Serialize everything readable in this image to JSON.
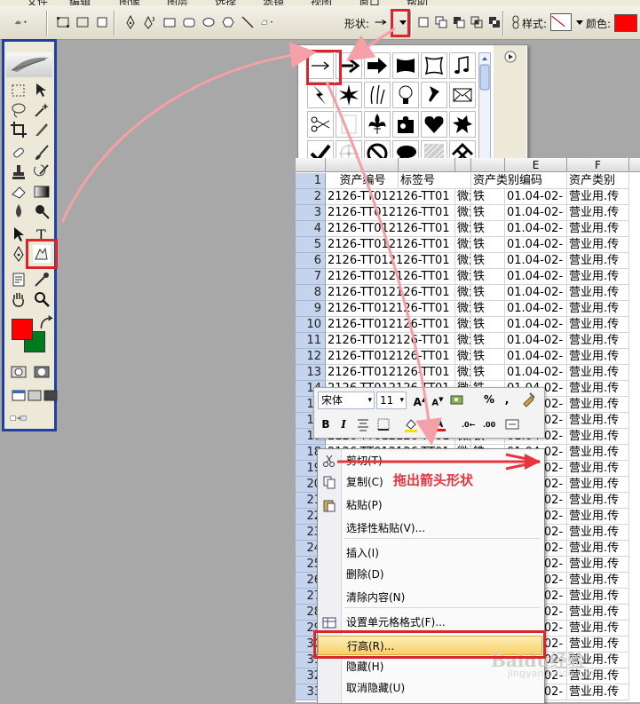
{
  "menubar": {
    "items": [
      "文件",
      "编辑",
      "图像",
      "图层",
      "选择",
      "滤镜",
      "视图",
      "窗口",
      "帮助"
    ]
  },
  "options_bar": {
    "shape_label": "形状:",
    "style_label": "样式:",
    "color_label": "颜色:",
    "color_value": "#ff0000"
  },
  "shapes_panel": {
    "shapes": [
      "thin-arrow",
      "arrow",
      "bold-arrow",
      "banner",
      "frame",
      "music-note",
      "lightning",
      "starburst",
      "grass",
      "lightbulb",
      "pushpin",
      "envelope",
      "scissors",
      "blank-page",
      "fleur-de-lis",
      "puzzle",
      "heart",
      "splat",
      "checkmark",
      "target",
      "no-sign",
      "speech-bubble",
      "hatch-square",
      "checker-diamond"
    ]
  },
  "sheet": {
    "columns": [
      {
        "letter": "",
        "title": ""
      },
      {
        "letter": "",
        "title": "资产编号"
      },
      {
        "letter": "",
        "title": "标签号"
      },
      {
        "letter": "",
        "title": ""
      },
      {
        "letter": "",
        "title": "资产类别编码"
      },
      {
        "letter": "E",
        "title": ""
      },
      {
        "letter": "F",
        "title": "资产类别"
      },
      {
        "letter": "",
        "title": ""
      }
    ],
    "top_row_text": {
      "num": "1",
      "a": "资产编号",
      "b": "标签号",
      "c": "资产类别编码",
      "d": "资产类别"
    },
    "row_cells": [
      "2126-TT012126-TT01",
      "微波i",
      "铁",
      "01.04-02-",
      "营业用.传"
    ],
    "rows": [
      "2",
      "3",
      "4",
      "5",
      "6",
      "7",
      "8",
      "9",
      "10",
      "11",
      "12",
      "13",
      "14",
      "15",
      "16",
      "17",
      "18",
      "19",
      "20",
      "21",
      "22",
      "23",
      "24",
      "25",
      "26",
      "27",
      "28",
      "29",
      "30",
      "31",
      "32",
      "33"
    ]
  },
  "mini_toolbar": {
    "font_name": "宋体",
    "font_size": "11",
    "buttons": [
      "B",
      "I",
      "%",
      ","
    ]
  },
  "context_menu": {
    "items": [
      {
        "label": "剪切(T)",
        "icon": "scissors-icon"
      },
      {
        "label": "复制(C)",
        "icon": "copy-icon"
      },
      {
        "label": "粘贴(P)",
        "icon": "paste-icon"
      },
      {
        "label": "选择性粘贴(V)...",
        "icon": ""
      },
      {
        "label": "插入(I)",
        "icon": ""
      },
      {
        "label": "删除(D)",
        "icon": ""
      },
      {
        "label": "清除内容(N)",
        "icon": ""
      },
      {
        "label": "设置单元格格式(F)...",
        "icon": "format-cells-icon"
      },
      {
        "label": "行高(R)...",
        "icon": ""
      },
      {
        "label": "隐藏(H)",
        "icon": ""
      },
      {
        "label": "取消隐藏(U)",
        "icon": ""
      }
    ]
  },
  "annotation": {
    "text": "拖出箭头形状",
    "color": "#e8343d"
  },
  "watermark": {
    "text": "Baidu经验",
    "sub": "jingyan.baidu.com"
  }
}
